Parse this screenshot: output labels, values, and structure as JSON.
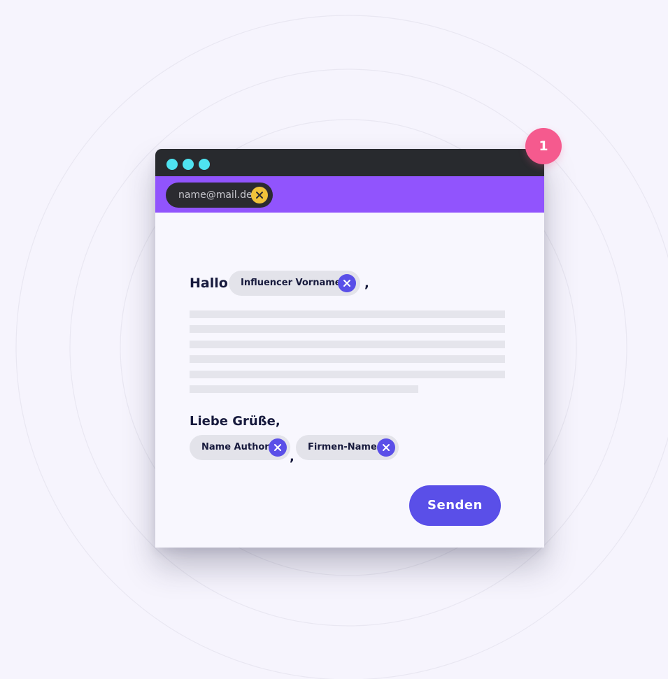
{
  "recipient": {
    "email": "name@mail.de",
    "remove_icon": "close-icon"
  },
  "badge": {
    "number": "1"
  },
  "email_body": {
    "greeting": "Hallo",
    "greeting_chip": "Influencer Vorname",
    "greeting_comma": ",",
    "signoff": "Liebe Grüße,",
    "author_chip": "Name Author",
    "separator_comma": ",",
    "company_chip": "Firmen-Name"
  },
  "actions": {
    "send_label": "Senden"
  },
  "colors": {
    "background": "#f6f4fd",
    "titlebar": "#282a2e",
    "window_dots": "#4fe3f0",
    "address_bar": "#9154fd",
    "accent": "#5a4fe8",
    "badge": "#f55a8e",
    "recipient_remove": "#f0c33a",
    "text_dark": "#171a3d"
  }
}
